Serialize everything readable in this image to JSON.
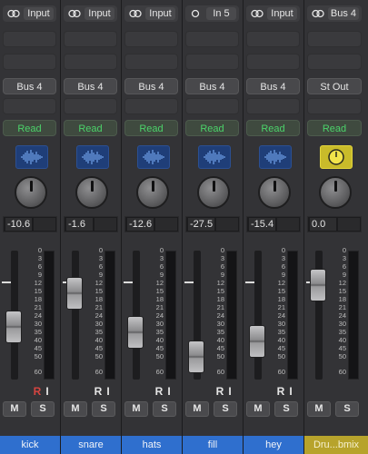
{
  "strips": [
    {
      "input": "Input",
      "output": "Bus 4",
      "auto": "Read",
      "volume": "-10.6",
      "name": "kick",
      "mute": "M",
      "solo": "S",
      "rec": "R",
      "inmon": "I"
    },
    {
      "input": "Input",
      "output": "Bus 4",
      "auto": "Read",
      "volume": "-1.6",
      "name": "snare",
      "mute": "M",
      "solo": "S",
      "rec": "R",
      "inmon": "I"
    },
    {
      "input": "Input",
      "output": "Bus 4",
      "auto": "Read",
      "volume": "-12.6",
      "name": "hats",
      "mute": "M",
      "solo": "S",
      "rec": "R",
      "inmon": "I"
    },
    {
      "input": "In 5",
      "output": "Bus 4",
      "auto": "Read",
      "volume": "-27.5",
      "name": "fill",
      "mute": "M",
      "solo": "S",
      "rec": "R",
      "inmon": "I"
    },
    {
      "input": "Input",
      "output": "Bus 4",
      "auto": "Read",
      "volume": "-15.4",
      "name": "hey",
      "mute": "M",
      "solo": "S",
      "rec": "R",
      "inmon": "I"
    },
    {
      "input": "Bus 4",
      "output": "St Out",
      "auto": "Read",
      "volume": "0.0",
      "name": "Dru...bmix",
      "mute": "M",
      "solo": "S"
    }
  ],
  "fader_scale": [
    "0",
    "3",
    "6",
    "9",
    "12",
    "15",
    "18",
    "21",
    "24",
    "30",
    "35",
    "40",
    "45",
    "50",
    "60"
  ],
  "icons": {
    "link": "stereo-link-icon",
    "mono": "mono-input-icon",
    "waveform": "audio-waveform-icon",
    "aux": "aux-icon"
  },
  "colors": {
    "track_name_bg": "#2f6fce",
    "aux_name_bg": "#b7a32c",
    "read_text": "#4bd36a",
    "record_red": "#d54440"
  }
}
